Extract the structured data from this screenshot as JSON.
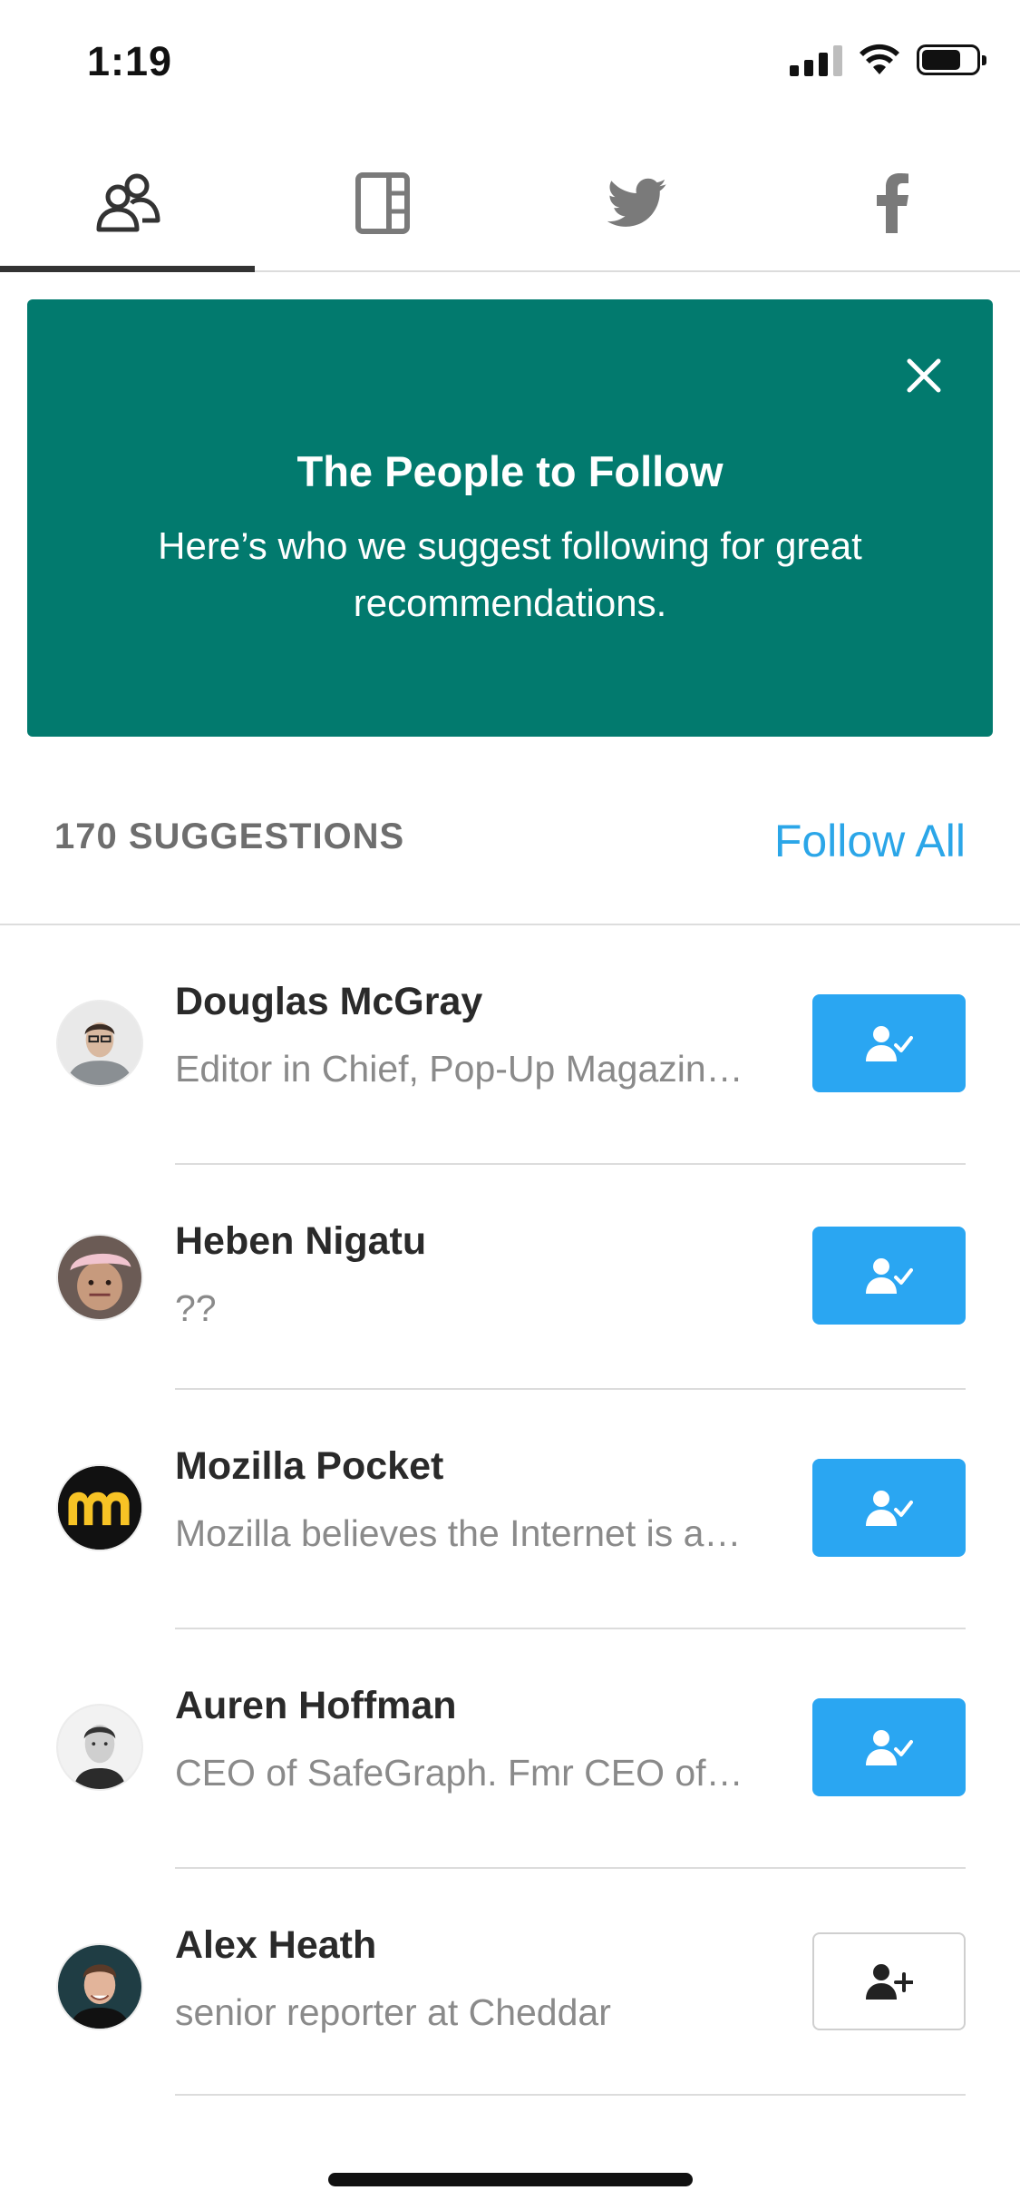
{
  "status_bar": {
    "time": "1:19"
  },
  "tabs": [
    {
      "label": "People",
      "icon": "people-icon",
      "active": true
    },
    {
      "label": "Publications",
      "icon": "publication-icon",
      "active": false
    },
    {
      "label": "Twitter",
      "icon": "twitter-icon",
      "active": false
    },
    {
      "label": "Facebook",
      "icon": "facebook-icon",
      "active": false
    }
  ],
  "banner": {
    "title": "The People to Follow",
    "text": "Here’s who we suggest following for great recommendations.",
    "background": "#027a6e"
  },
  "suggestions": {
    "count_label": "170 SUGGESTIONS",
    "follow_all_label": "Follow All",
    "accent": "#2aa6f2"
  },
  "people": [
    {
      "name": "Douglas McGray",
      "bio": "Editor in Chief, Pop-Up Magazin…",
      "following": true,
      "button_icon": "user-check-icon"
    },
    {
      "name": "Heben Nigatu",
      "bio": "??",
      "following": true,
      "button_icon": "user-check-icon"
    },
    {
      "name": "Mozilla Pocket",
      "bio": "Mozilla believes the Internet is a…",
      "following": true,
      "button_icon": "user-check-icon"
    },
    {
      "name": "Auren Hoffman",
      "bio": "CEO of SafeGraph. Fmr CEO of…",
      "following": true,
      "button_icon": "user-check-icon"
    },
    {
      "name": "Alex Heath",
      "bio": "senior reporter at Cheddar",
      "following": false,
      "button_icon": "user-plus-icon"
    }
  ]
}
